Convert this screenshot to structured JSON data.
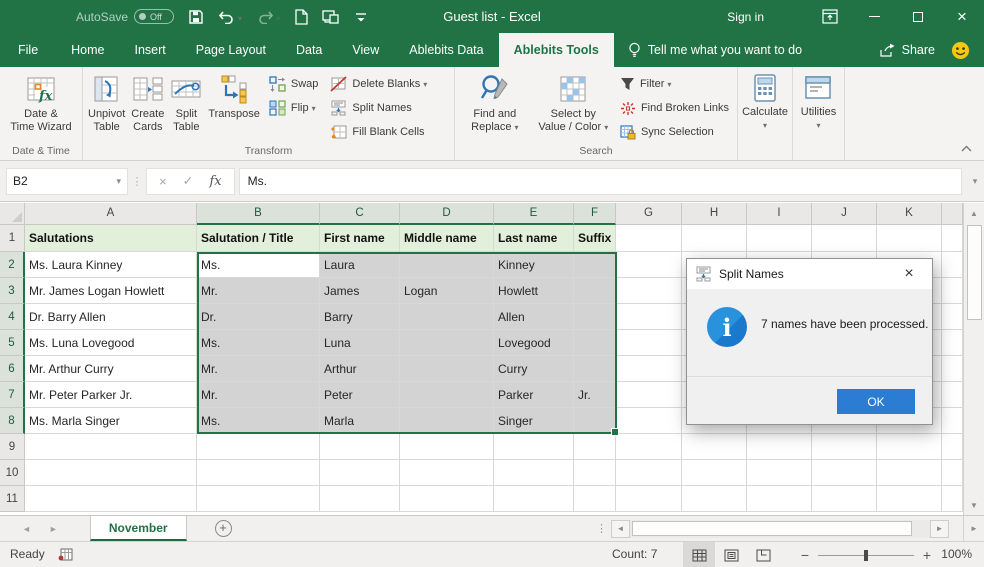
{
  "colors": {
    "excel_green": "#217346",
    "selection_fill": "#d3d3d3",
    "row1_fill": "#e2efda",
    "ok_button_blue": "#2b7cd3",
    "info_icon_blue": "#2a91dd"
  },
  "title_bar": {
    "autosave_label": "AutoSave",
    "autosave_state": "Off",
    "title": "Guest list - Excel",
    "sign_in": "Sign in"
  },
  "tabs": [
    {
      "label": "File"
    },
    {
      "label": "Home"
    },
    {
      "label": "Insert"
    },
    {
      "label": "Page Layout"
    },
    {
      "label": "Data"
    },
    {
      "label": "View"
    },
    {
      "label": "Ablebits Data"
    },
    {
      "label": "Ablebits Tools",
      "active": true
    }
  ],
  "tell_me": "Tell me what you want to do",
  "share_label": "Share",
  "ribbon": {
    "date_time_group": {
      "label": "Date & Time",
      "wizard_line1": "Date &",
      "wizard_line2": "Time Wizard"
    },
    "transform_group": {
      "label": "Transform",
      "unpivot_line1": "Unpivot",
      "unpivot_line2": "Table",
      "cards_line1": "Create",
      "cards_line2": "Cards",
      "split_line1": "Split",
      "split_line2": "Table",
      "transpose": "Transpose",
      "swap": "Swap",
      "flip": "Flip",
      "delete_blanks": "Delete Blanks",
      "split_names": "Split Names",
      "fill_blank_cells": "Fill Blank Cells"
    },
    "search_group": {
      "label": "Search",
      "find_line1": "Find and",
      "find_line2": "Replace",
      "select_line1": "Select by",
      "select_line2": "Value / Color",
      "filter": "Filter",
      "find_broken_links": "Find Broken Links",
      "sync_selection": "Sync Selection"
    },
    "calculate_label": "Calculate",
    "utilities_label": "Utilities"
  },
  "formula_bar": {
    "name_box": "B2",
    "content": "Ms."
  },
  "grid": {
    "column_letters": [
      "A",
      "B",
      "C",
      "D",
      "E",
      "F",
      "G",
      "H",
      "I",
      "J",
      "K"
    ],
    "selected_columns": [
      "B",
      "C",
      "D",
      "E",
      "F"
    ],
    "selected_rows": [
      2,
      3,
      4,
      5,
      6,
      7,
      8
    ],
    "active_cell": "B2",
    "selection_range": "B2:F8",
    "rows": [
      {
        "n": 1,
        "cells": {
          "A": "Salutations",
          "B": "Salutation / Title",
          "C": "First name",
          "D": "Middle name",
          "E": "Last name",
          "F": "Suffix"
        }
      },
      {
        "n": 2,
        "cells": {
          "A": "Ms. Laura Kinney",
          "B": "Ms.",
          "C": "Laura",
          "E": "Kinney"
        }
      },
      {
        "n": 3,
        "cells": {
          "A": "Mr. James Logan Howlett",
          "B": "Mr.",
          "C": "James",
          "D": "Logan",
          "E": "Howlett"
        }
      },
      {
        "n": 4,
        "cells": {
          "A": "Dr. Barry Allen",
          "B": "Dr.",
          "C": "Barry",
          "E": "Allen"
        }
      },
      {
        "n": 5,
        "cells": {
          "A": "Ms. Luna Lovegood",
          "B": "Ms.",
          "C": "Luna",
          "E": "Lovegood"
        }
      },
      {
        "n": 6,
        "cells": {
          "A": "Mr. Arthur Curry",
          "B": "Mr.",
          "C": "Arthur",
          "E": "Curry"
        }
      },
      {
        "n": 7,
        "cells": {
          "A": "Mr. Peter Parker Jr.",
          "B": "Mr.",
          "C": "Peter",
          "E": "Parker",
          "F": "Jr."
        }
      },
      {
        "n": 8,
        "cells": {
          "A": "Ms. Marla Singer",
          "B": "Ms.",
          "C": "Marla",
          "E": "Singer"
        }
      },
      {
        "n": 9,
        "cells": {}
      },
      {
        "n": 10,
        "cells": {}
      },
      {
        "n": 11,
        "cells": {}
      }
    ]
  },
  "dialog": {
    "title": "Split Names",
    "message": "7 names have been processed.",
    "ok_label": "OK"
  },
  "sheet_bar": {
    "active_tab": "November"
  },
  "status_bar": {
    "mode": "Ready",
    "count": "Count: 7",
    "zoom_level": "100%"
  }
}
